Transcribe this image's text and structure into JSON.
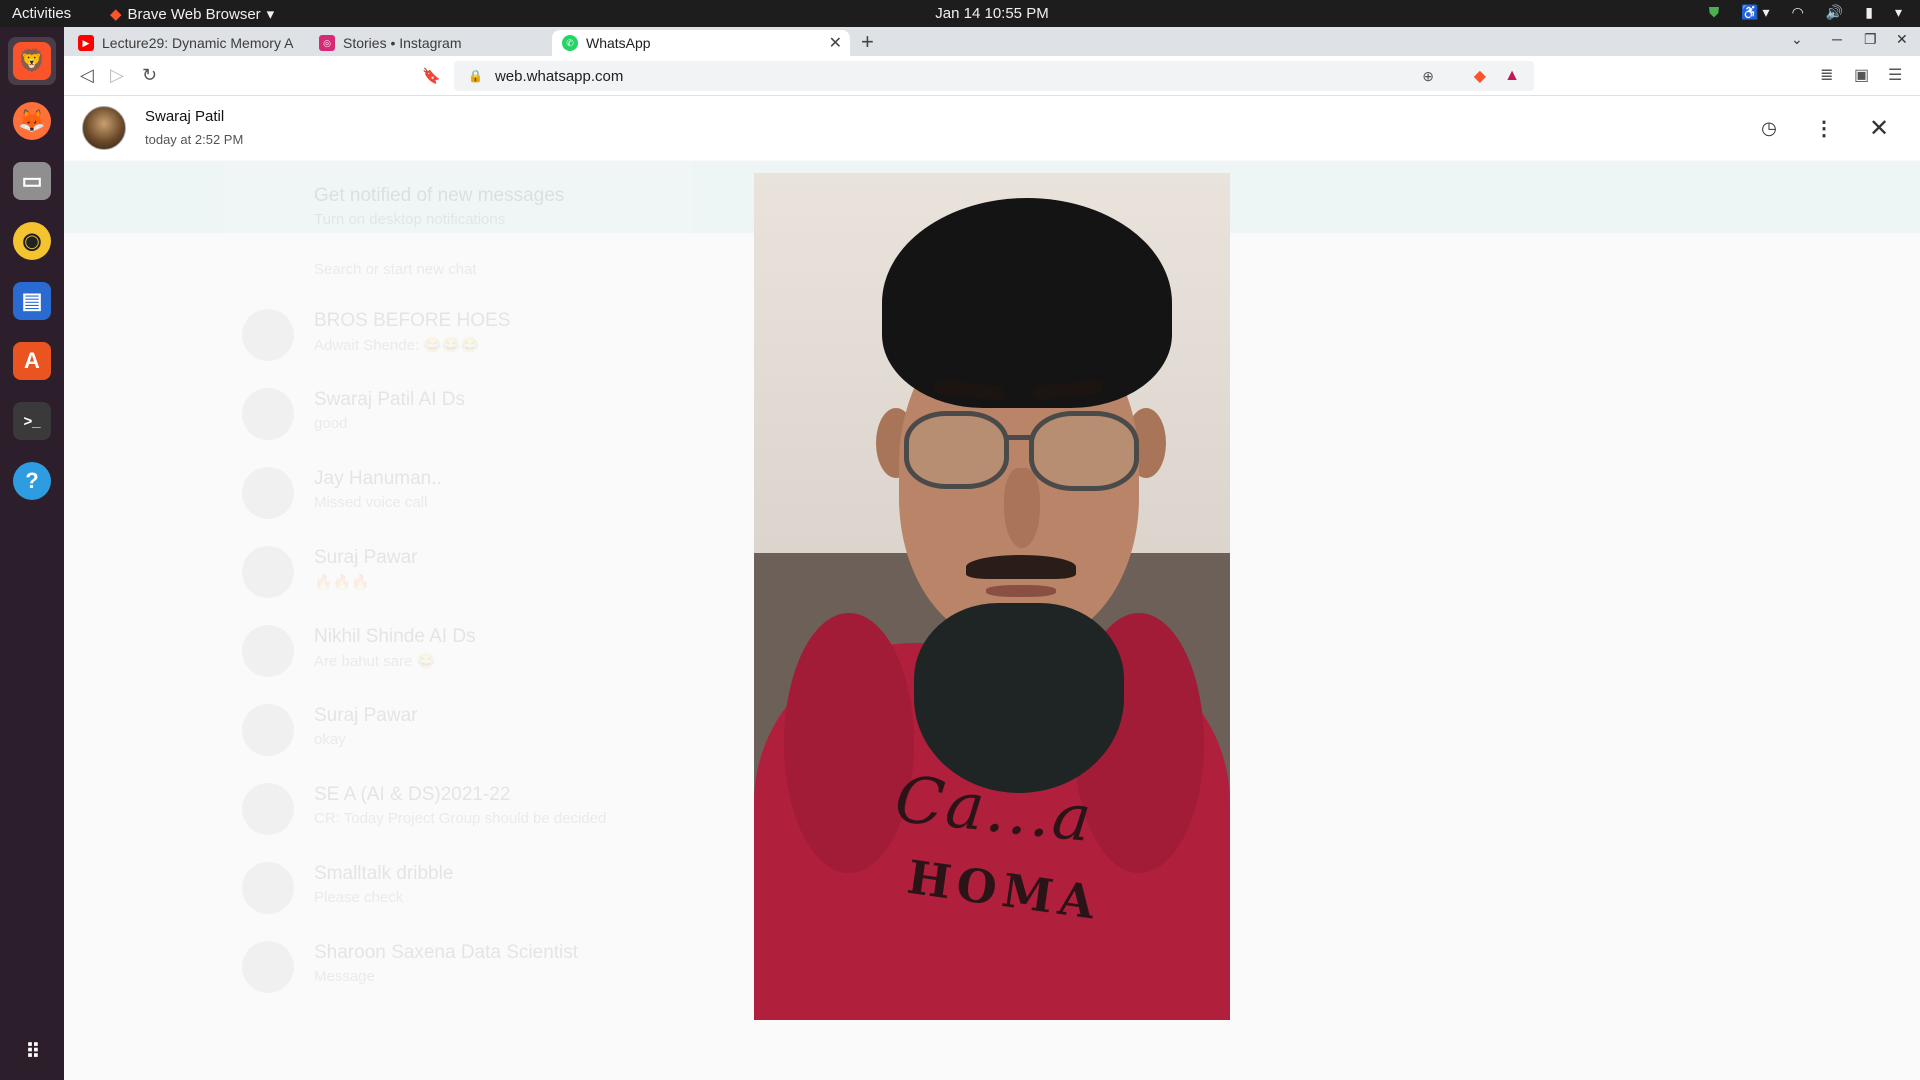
{
  "topbar": {
    "activities": "Activities",
    "app_name": "Brave Web Browser",
    "clock": "Jan 14  10:55 PM"
  },
  "tabs": [
    {
      "title": "Lecture29: Dynamic Memory A",
      "favicon": "youtube-icon",
      "color": "#ff0000"
    },
    {
      "title": "Stories • Instagram",
      "favicon": "instagram-icon",
      "color": "#d62976"
    },
    {
      "title": "WhatsApp",
      "favicon": "whatsapp-icon",
      "color": "#25d366",
      "active": true
    }
  ],
  "address_bar": {
    "url": "web.whatsapp.com"
  },
  "status_viewer": {
    "contact_name": "Swaraj Patil",
    "posted_time": "today at 2:52 PM"
  },
  "background_chat": {
    "notification_title": "Get notified of new messages",
    "notification_sub": "Turn on desktop notifications",
    "search_placeholder": "Search or start new chat",
    "chats": [
      {
        "name": "BROS BEFORE HOES",
        "message": "Adwait Shende: 😂😂😂"
      },
      {
        "name": "Swaraj Patil AI Ds",
        "message": "good"
      },
      {
        "name": "Jay Hanuman..",
        "message": "Missed voice call"
      },
      {
        "name": "Suraj Pawar",
        "message": "🔥🔥🔥"
      },
      {
        "name": "Nikhil Shinde AI Ds",
        "message": "Are bahut sare 😂"
      },
      {
        "name": "Suraj Pawar",
        "message": "okay"
      },
      {
        "name": "SE A (AI & DS)2021-22",
        "message": "CR: Today Project Group should be decided"
      },
      {
        "name": "Smalltalk dribble",
        "message": "Please check"
      },
      {
        "name": "Sharoon Saxena Data Scientist",
        "message": "Message"
      }
    ]
  },
  "dock": [
    {
      "name": "brave-icon",
      "color": "#fb542b",
      "glyph": "🦁"
    },
    {
      "name": "firefox-icon",
      "color": "#ff7139",
      "glyph": "🦊"
    },
    {
      "name": "files-icon",
      "color": "#8f8f8f",
      "glyph": "▭"
    },
    {
      "name": "rhythmbox-icon",
      "color": "#f4c430",
      "glyph": "◉"
    },
    {
      "name": "writer-icon",
      "color": "#2a6bd1",
      "glyph": "▤"
    },
    {
      "name": "software-icon",
      "color": "#e95420",
      "glyph": "A"
    },
    {
      "name": "terminal-icon",
      "color": "#3a3a3a",
      "glyph": ">_"
    },
    {
      "name": "help-icon",
      "color": "#2d9ce0",
      "glyph": "?"
    }
  ],
  "photo": {
    "print_text": "Ca...a",
    "print_text2": "HOMA"
  }
}
